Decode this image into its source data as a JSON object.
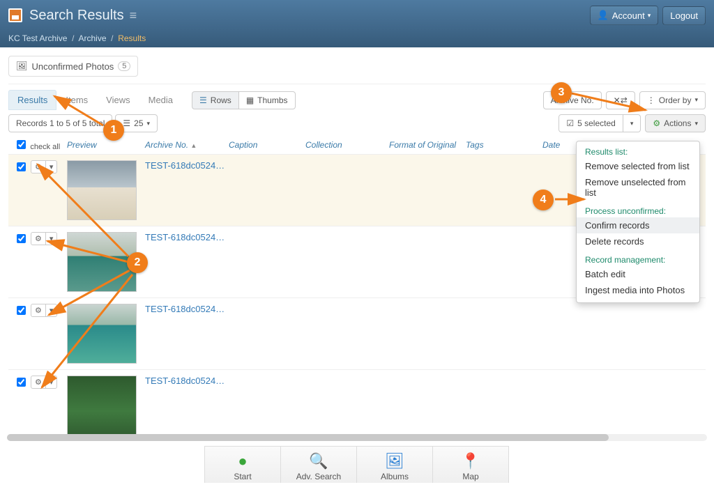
{
  "app": {
    "title": "Search Results"
  },
  "account": {
    "label": "Account",
    "logout": "Logout"
  },
  "breadcrumbs": {
    "a": "KC Test Archive",
    "b": "Archive",
    "c": "Results"
  },
  "filterTab": {
    "label": "Unconfirmed Photos",
    "count": "5"
  },
  "tabs": {
    "results": "Results",
    "items": "Items",
    "views": "Views",
    "media": "Media"
  },
  "viewmode": {
    "rows": "Rows",
    "thumbs": "Thumbs"
  },
  "sortby": {
    "label": "Archive No."
  },
  "orderby": {
    "label": "Order by"
  },
  "records": {
    "summary": "Records 1 to 5 of 5 total",
    "pagesize": "25"
  },
  "selection": {
    "count": "5 selected"
  },
  "actions": {
    "label": "Actions"
  },
  "columns": {
    "checkall": "check all",
    "preview": "Preview",
    "archive": "Archive No.",
    "caption": "Caption",
    "collection": "Collection",
    "format": "Format of Original",
    "tags": "Tags",
    "date": "Date"
  },
  "rows": [
    {
      "archive": "TEST-618dc0524…"
    },
    {
      "archive": "TEST-618dc0524…"
    },
    {
      "archive": "TEST-618dc0524…"
    },
    {
      "archive": "TEST-618dc0524…"
    }
  ],
  "menu": {
    "h1": "Results list:",
    "i1": "Remove selected from list",
    "i2": "Remove unselected from list",
    "h2": "Process unconfirmed:",
    "i3": "Confirm records",
    "i4": "Delete records",
    "h3": "Record management:",
    "i5": "Batch edit",
    "i6": "Ingest media into Photos"
  },
  "bottom": {
    "start": "Start",
    "adv": "Adv. Search",
    "albums": "Albums",
    "map": "Map"
  },
  "annotations": {
    "b1": "1",
    "b2": "2",
    "b3": "3",
    "b4": "4"
  }
}
